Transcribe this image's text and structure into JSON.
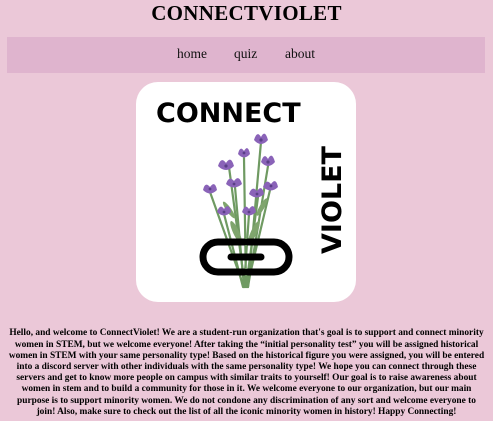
{
  "site": {
    "title": "CONNECTVIOLET"
  },
  "nav": {
    "items": [
      {
        "label": "home"
      },
      {
        "label": "quiz"
      },
      {
        "label": "about"
      }
    ]
  },
  "logo": {
    "line1": "CONNECT",
    "line2": "VIOLET",
    "background": "#ffffff",
    "flower_color": "#8a63b8",
    "stem_color": "#6f9a62"
  },
  "intro": {
    "text": "Hello, and welcome to ConnectViolet! We are a student-run organization that's goal is to support and connect minority women in STEM, but we welcome everyone! After taking the “initial personality test” you will be assigned historical women in STEM with your same personality type! Based on the historical figure you were assigned, you will be entered into a discord server with other individuals with the same personality type! We hope you can connect through these servers and get to know more people on campus with similar traits to yourself! Our goal is to raise awareness about women in stem and to build a community for those in it. We welcome everyone to our organization, but our main purpose is to support minority women. We do not condone any discrimination of any sort and welcome everyone to join! Also, make sure to check out the list of all the iconic minority women in history! Happy Connecting!"
  },
  "colors": {
    "page_background": "#ebc8d8",
    "navbar_background": "#dfb4ce"
  }
}
